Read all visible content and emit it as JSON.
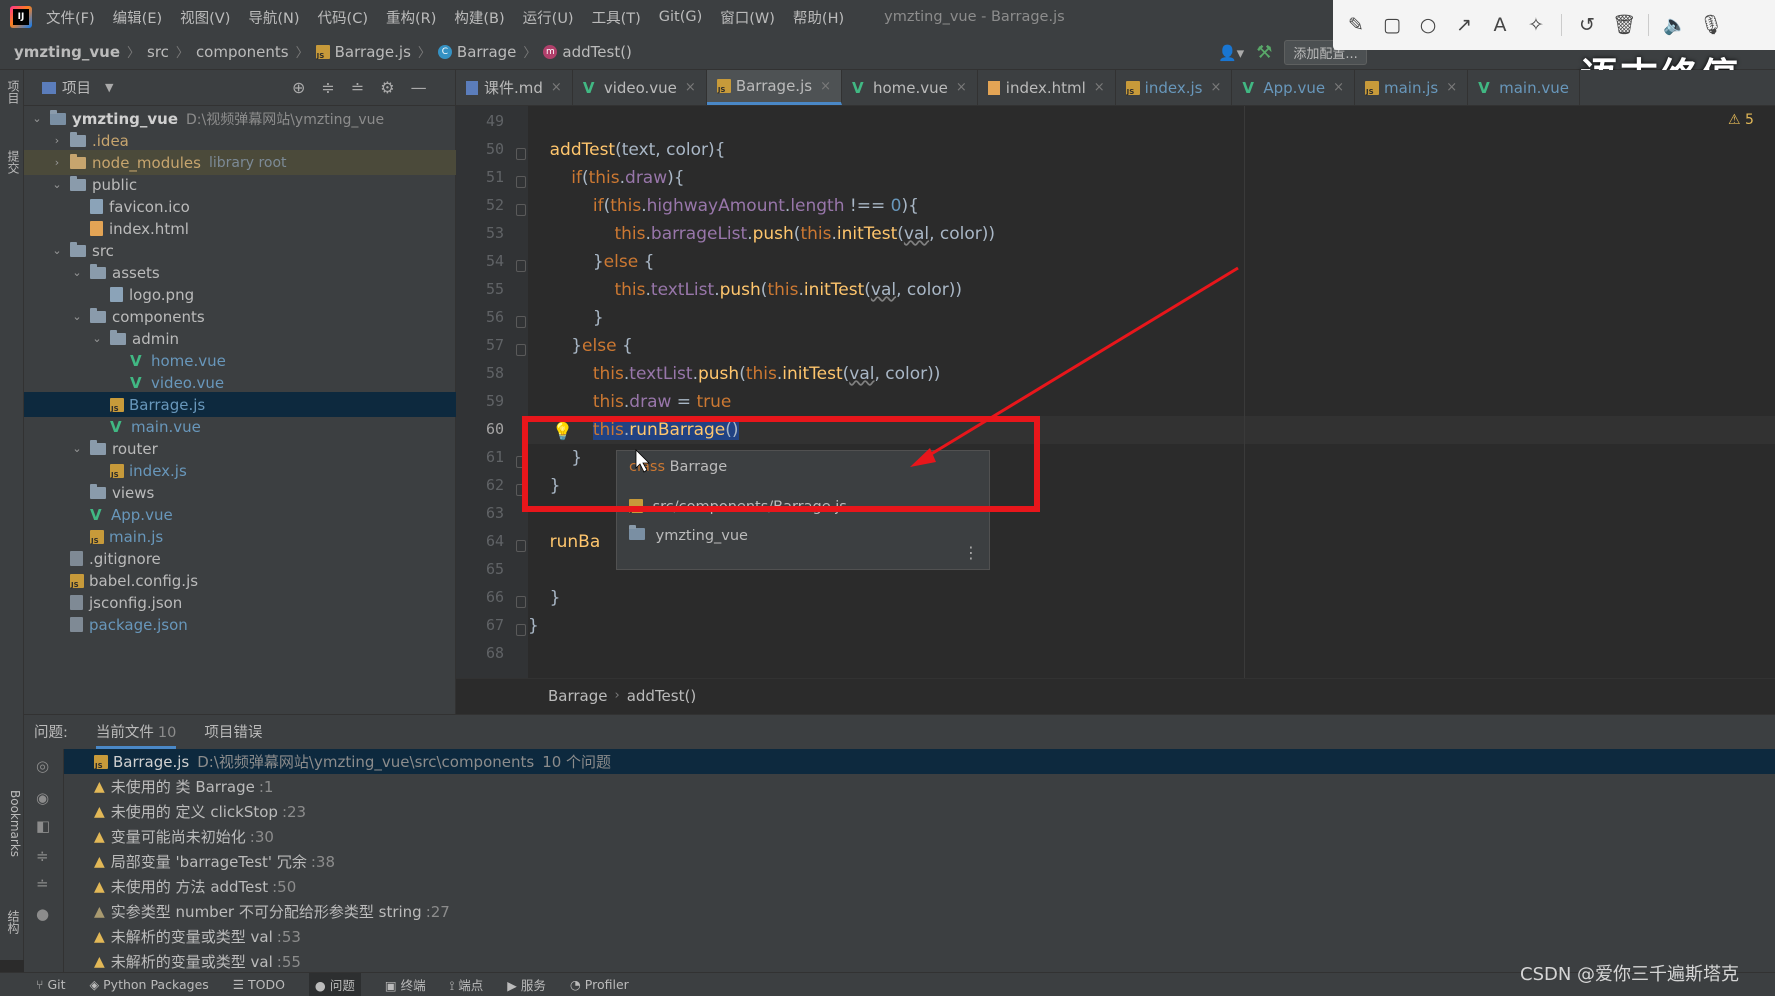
{
  "menu": {
    "items": [
      "文件(F)",
      "编辑(E)",
      "视图(V)",
      "导航(N)",
      "代码(C)",
      "重构(R)",
      "构建(B)",
      "运行(U)",
      "工具(T)",
      "Git(G)",
      "窗口(W)",
      "帮助(H)"
    ],
    "window_title": "ymzting_vue - Barrage.js"
  },
  "overlay": {
    "tools": [
      "pen-icon",
      "rectangle-icon",
      "circle-icon",
      "arrow-icon",
      "text-icon",
      "magic-wand-icon",
      "undo-icon",
      "trash-icon",
      "speaker-icon",
      "microphone-icon"
    ],
    "watermark": "语末终停"
  },
  "nav": {
    "project": "ymzting_vue",
    "crumbs": [
      "src",
      "components",
      "Barrage.js",
      "Barrage",
      "addTest()"
    ],
    "add_config": "添加配置..."
  },
  "sidebar_tabs": {
    "project": "项目",
    "commit": "提交",
    "bookmarks": "Bookmarks",
    "structure": "结构"
  },
  "project_panel": {
    "title": "项目",
    "tree": [
      {
        "name": "ymzting_vue",
        "extra": "D:\\视频弹幕网站\\ymzting_vue"
      },
      {
        "name": ".idea"
      },
      {
        "name": "node_modules",
        "extra": "library root"
      },
      {
        "name": "public"
      },
      {
        "name": "favicon.ico"
      },
      {
        "name": "index.html"
      },
      {
        "name": "src"
      },
      {
        "name": "assets"
      },
      {
        "name": "logo.png"
      },
      {
        "name": "components"
      },
      {
        "name": "admin"
      },
      {
        "name": "home.vue"
      },
      {
        "name": "video.vue"
      },
      {
        "name": "Barrage.js"
      },
      {
        "name": "main.vue"
      },
      {
        "name": "router"
      },
      {
        "name": "index.js"
      },
      {
        "name": "views"
      },
      {
        "name": "App.vue"
      },
      {
        "name": "main.js"
      },
      {
        "name": ".gitignore"
      },
      {
        "name": "babel.config.js"
      },
      {
        "name": "jsconfig.json"
      },
      {
        "name": "package.json"
      }
    ]
  },
  "editor": {
    "tabs": [
      "课件.md",
      "video.vue",
      "Barrage.js",
      "home.vue",
      "index.html",
      "index.js",
      "App.vue",
      "main.js",
      "main.vue"
    ],
    "active_tab": "Barrage.js",
    "line_numbers": [
      "49",
      "50",
      "51",
      "52",
      "53",
      "54",
      "55",
      "56",
      "57",
      "58",
      "59",
      "60",
      "61",
      "62",
      "63",
      "64",
      "65",
      "66",
      "67",
      "68"
    ],
    "warning_count": "5",
    "breadcrumbs": [
      "Barrage",
      "addTest()"
    ],
    "popup": {
      "keyword": "class",
      "class_name": "Barrage",
      "path": "src/components/Barrage.js",
      "project": "ymzting_vue"
    }
  },
  "problems": {
    "tabs": {
      "label": "问题:",
      "current": "当前文件",
      "current_count": "10",
      "project": "项目错误"
    },
    "file": {
      "name": "Barrage.js",
      "path": "D:\\视频弹幕网站\\ymzting_vue\\src\\components",
      "count": "10 个问题"
    },
    "items": [
      {
        "text": "未使用的 类 Barrage",
        "line": ":1"
      },
      {
        "text": "未使用的 定义 clickStop",
        "line": ":23"
      },
      {
        "text": "变量可能尚未初始化",
        "line": ":30"
      },
      {
        "text": "局部变量 'barrageTest' 冗余",
        "line": ":38"
      },
      {
        "text": "未使用的 方法 addTest",
        "line": ":50"
      },
      {
        "text": "实参类型 number 不可分配给形参类型 string",
        "line": ":27"
      },
      {
        "text": "未解析的变量或类型 val",
        "line": ":53"
      },
      {
        "text": "未解析的变量或类型 val",
        "line": ":55"
      }
    ]
  },
  "bottom_bar": [
    "Git",
    "Python Packages",
    "TODO",
    "问题",
    "终端",
    "端点",
    "服务",
    "Profiler"
  ],
  "watermark_bottom": "CSDN @爱你三千遍斯塔克"
}
